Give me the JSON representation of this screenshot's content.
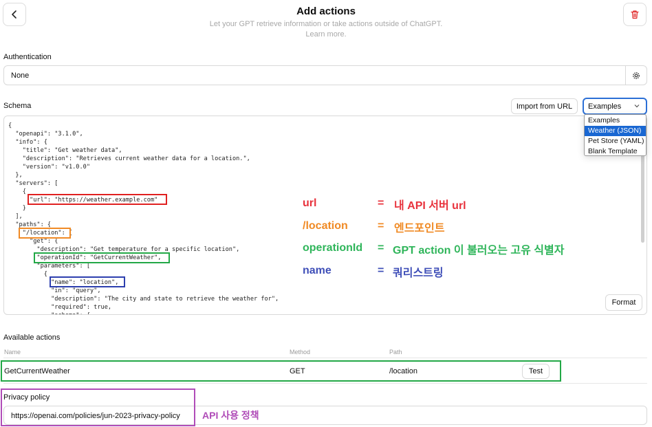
{
  "header": {
    "title": "Add actions",
    "subtitle": "Let your GPT retrieve information or take actions outside of ChatGPT.",
    "learn_more": "Learn more."
  },
  "authentication": {
    "label": "Authentication",
    "value": "None"
  },
  "schema": {
    "label": "Schema",
    "import_label": "Import from URL",
    "examples_selected": "Examples",
    "dropdown_options": [
      "Examples",
      "Weather (JSON)",
      "Pet Store (YAML)",
      "Blank Template"
    ],
    "dropdown_highlighted": "Weather (JSON)",
    "format_label": "Format",
    "code_lines": [
      "{",
      "  \"openapi\": \"3.1.0\",",
      "  \"info\": {",
      "    \"title\": \"Get weather data\",",
      "    \"description\": \"Retrieves current weather data for a location.\",",
      "    \"version\": \"v1.0.0\"",
      "  },",
      "  \"servers\": [",
      "    {",
      "      \"url\": \"https://weather.example.com\"",
      "    }",
      "  ],",
      "  \"paths\": {",
      "    \"/location\": {",
      "      \"get\": {",
      "        \"description\": \"Get temperature for a specific location\",",
      "        \"operationId\": \"GetCurrentWeather\",",
      "        \"parameters\": [",
      "          {",
      "            \"name\": \"location\",",
      "            \"in\": \"query\",",
      "            \"description\": \"The city and state to retrieve the weather for\",",
      "            \"required\": true,",
      "            \"schema\": {"
    ]
  },
  "annotations": {
    "url_key": "url",
    "url_desc": "내 API 서버 url",
    "location_key": "/location",
    "location_desc": "엔드포인트",
    "operation_key": "operationId",
    "operation_desc": "GPT action 이 불러오는 고유 식별자",
    "name_key": "name",
    "name_desc": "쿼리스트링",
    "equals": "=",
    "privacy_note": "API 사용 정책"
  },
  "actions": {
    "label": "Available actions",
    "columns": {
      "name": "Name",
      "method": "Method",
      "path": "Path"
    },
    "rows": [
      {
        "name": "GetCurrentWeather",
        "method": "GET",
        "path": "/location",
        "test_label": "Test"
      }
    ]
  },
  "privacy": {
    "label": "Privacy policy",
    "value": "https://openai.com/policies/jun-2023-privacy-policy"
  },
  "colors": {
    "red": "#e8323c",
    "orange": "#f08a24",
    "green": "#2fb55a",
    "blue": "#3f4fb8",
    "purple": "#b04cb8",
    "select_accent": "#2b6fd6"
  },
  "icons": [
    "chevron-left-icon",
    "trash-icon",
    "gear-icon",
    "chevron-down-icon"
  ]
}
